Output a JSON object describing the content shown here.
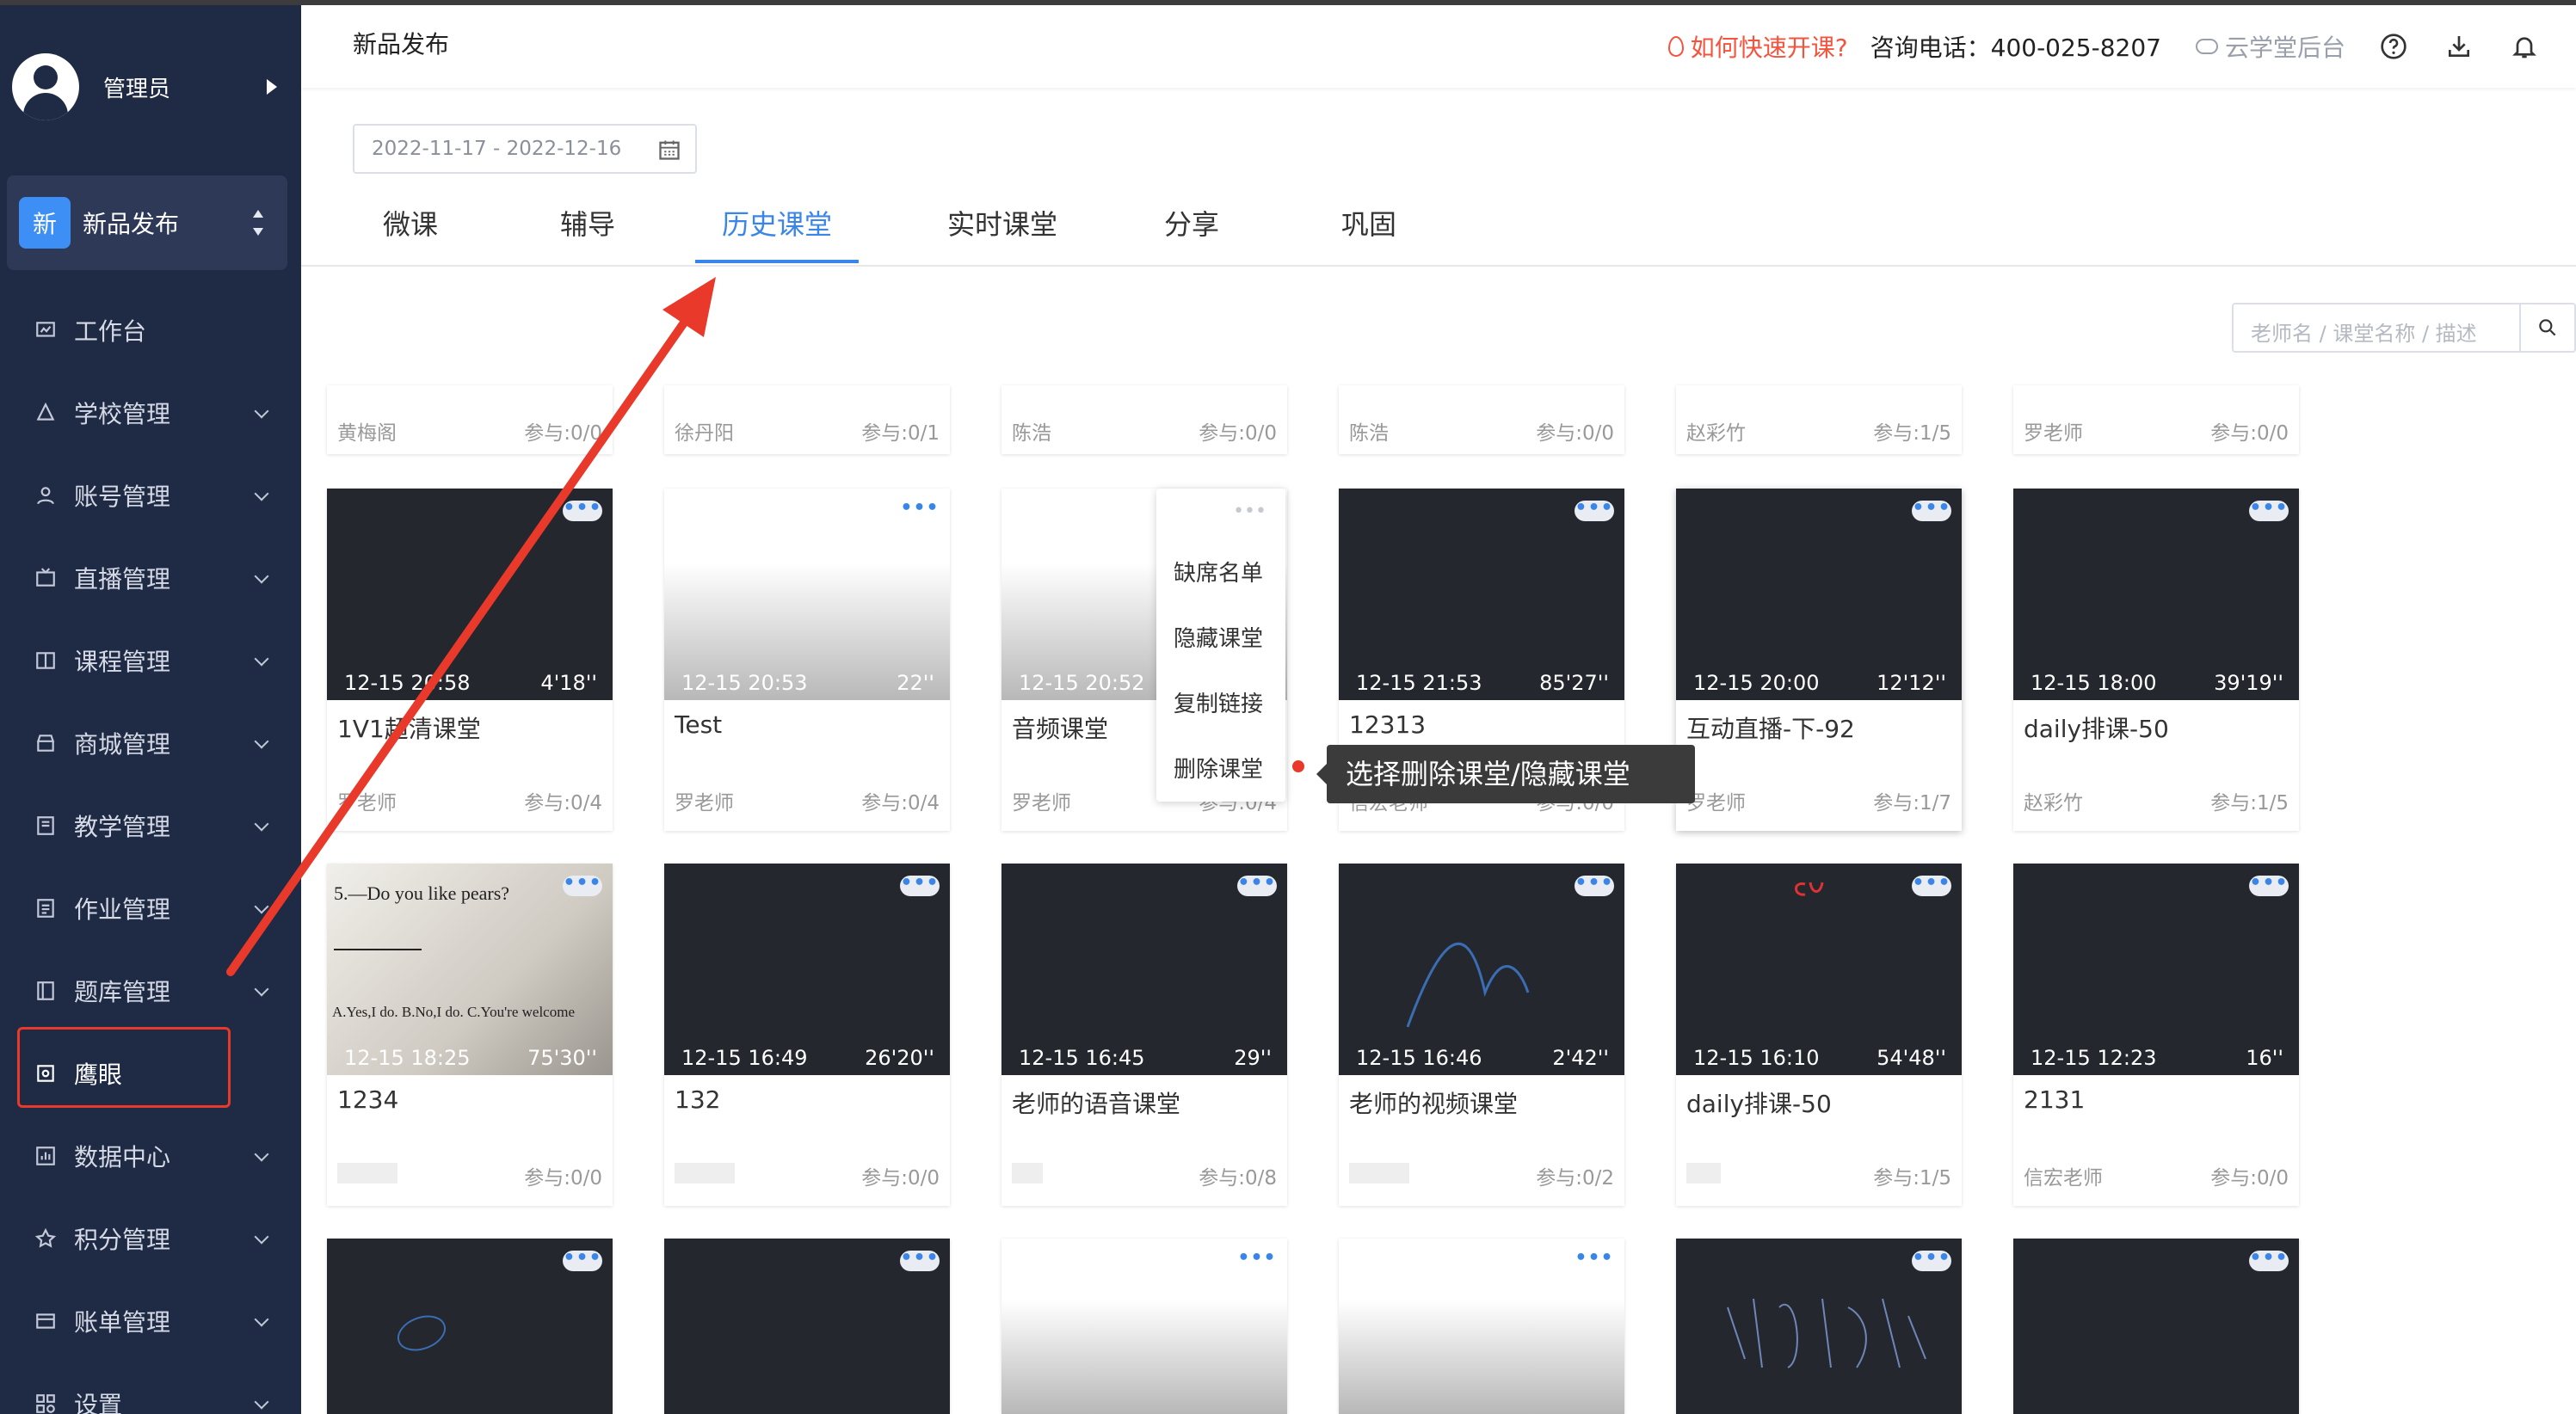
{
  "user": {
    "name": "管理员"
  },
  "app": {
    "badge": "新",
    "name": "新品发布"
  },
  "sidebar": {
    "items": [
      {
        "label": "工作台",
        "icon": "dashboard-icon"
      },
      {
        "label": "学校管理",
        "icon": "school-icon"
      },
      {
        "label": "账号管理",
        "icon": "account-icon"
      },
      {
        "label": "直播管理",
        "icon": "live-icon"
      },
      {
        "label": "课程管理",
        "icon": "course-icon"
      },
      {
        "label": "商城管理",
        "icon": "mall-icon"
      },
      {
        "label": "教学管理",
        "icon": "teaching-icon"
      },
      {
        "label": "作业管理",
        "icon": "homework-icon"
      },
      {
        "label": "题库管理",
        "icon": "question-bank-icon"
      },
      {
        "label": "鹰眼",
        "icon": "eagle-eye-icon"
      },
      {
        "label": "数据中心",
        "icon": "data-center-icon"
      },
      {
        "label": "积分管理",
        "icon": "points-icon"
      },
      {
        "label": "账单管理",
        "icon": "bill-icon"
      },
      {
        "label": "设置",
        "icon": "settings-icon"
      }
    ]
  },
  "header": {
    "title": "新品发布",
    "quick_start": "如何快速开课?",
    "phone": "咨询电话：400-025-8207",
    "backend": "云学堂后台"
  },
  "date_range": "2022-11-17 - 2022-12-16",
  "tabs": [
    "微课",
    "辅导",
    "历史课堂",
    "实时课堂",
    "分享",
    "巩固"
  ],
  "search": {
    "placeholder": "老师名 / 课堂名称 / 描述"
  },
  "top_row": [
    {
      "teacher": "黄梅阁",
      "join": "参与:0/0"
    },
    {
      "teacher": "徐丹阳",
      "join": "参与:0/1"
    },
    {
      "teacher": "陈浩",
      "join": "参与:0/0"
    },
    {
      "teacher": "陈浩",
      "join": "参与:0/0"
    },
    {
      "teacher": "赵彩竹",
      "join": "参与:1/5"
    },
    {
      "teacher": "罗老师",
      "join": "参与:0/0"
    }
  ],
  "row1": [
    {
      "date": "12-15 20:58",
      "dur": "4'18''",
      "title": "1V1超清课堂",
      "teacher": "罗老师",
      "join": "参与:0/4"
    },
    {
      "date": "12-15 20:53",
      "dur": "22''",
      "title": "Test",
      "teacher": "罗老师",
      "join": "参与:0/4"
    },
    {
      "date": "12-15 20:52",
      "dur": "",
      "title": "音频课堂",
      "teacher": "罗老师",
      "join": "参与:0/4"
    },
    {
      "date": "12-15 21:53",
      "dur": "85'27''",
      "title": "12313",
      "teacher": "信宏老师",
      "join": "参与:0/0"
    },
    {
      "date": "12-15 20:00",
      "dur": "12'12''",
      "title": "互动直播-下-92",
      "teacher": "罗老师",
      "join": "参与:1/7"
    },
    {
      "date": "12-15 18:00",
      "dur": "39'19''",
      "title": "daily排课-50",
      "teacher": "赵彩竹",
      "join": "参与:1/5"
    }
  ],
  "row2": [
    {
      "date": "12-15 18:25",
      "dur": "75'30''",
      "title": "1234",
      "teacher": "",
      "join": "参与:0/0"
    },
    {
      "date": "12-15 16:49",
      "dur": "26'20''",
      "title": "132",
      "teacher": "",
      "join": "参与:0/0"
    },
    {
      "date": "12-15 16:45",
      "dur": "29''",
      "title": "老师的语音课堂",
      "teacher": "",
      "join": "参与:0/8"
    },
    {
      "date": "12-15 16:46",
      "dur": "2'42''",
      "title": "老师的视频课堂",
      "teacher": "",
      "join": "参与:0/2"
    },
    {
      "date": "12-15 16:10",
      "dur": "54'48''",
      "title": "daily排课-50",
      "teacher": "",
      "join": "参与:1/5"
    },
    {
      "date": "12-15 12:23",
      "dur": "16''",
      "title": "2131",
      "teacher": "信宏老师",
      "join": "参与:0/0"
    }
  ],
  "context_menu": [
    "缺席名单",
    "隐藏课堂",
    "复制链接",
    "删除课堂"
  ],
  "tooltip": "选择删除课堂/隐藏课堂",
  "photo_text": {
    "q": "5.—Do you like pears?",
    "opts": "A.Yes,I do.   B.No,I do.   C.You're welcome"
  },
  "colors": {
    "sidebar": "#1f2a44",
    "accent": "#3a86e8",
    "annotation": "#e8392b"
  }
}
